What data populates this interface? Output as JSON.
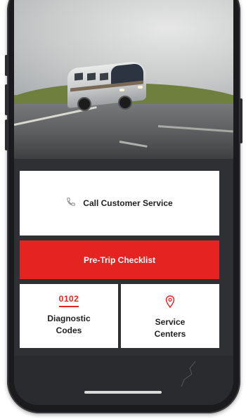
{
  "hero": {
    "image_desc_icon": "rv-photo-icon"
  },
  "actions": {
    "call": {
      "label": "Call Customer Service",
      "icon": "phone-icon"
    },
    "checklist": {
      "label": "Pre-Trip Checklist"
    },
    "diagnostic": {
      "code": "0102",
      "label_line1": "Diagnostic",
      "label_line2": "Codes"
    },
    "service": {
      "icon": "map-pin-icon",
      "label_line1": "Service",
      "label_line2": "Centers"
    }
  },
  "colors": {
    "accent": "#e52421",
    "screen_bg": "#2f3033",
    "card_bg": "#ffffff",
    "phone_frame": "#1b1b1d"
  }
}
